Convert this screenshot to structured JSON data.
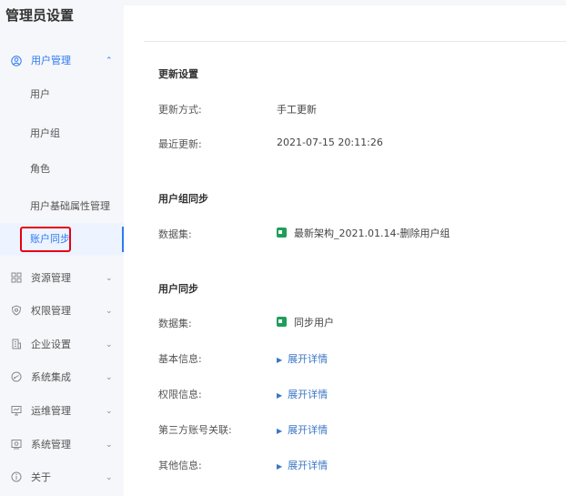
{
  "sidebar": {
    "title": "管理员设置",
    "user_mgmt": {
      "label": "用户管理",
      "subitems": [
        "用户",
        "用户组",
        "角色",
        "用户基础属性管理",
        "账户同步"
      ]
    },
    "groups": [
      {
        "label": "资源管理",
        "icon": "grid-icon"
      },
      {
        "label": "权限管理",
        "icon": "shield-icon"
      },
      {
        "label": "企业设置",
        "icon": "building-icon"
      },
      {
        "label": "系统集成",
        "icon": "integration-icon"
      },
      {
        "label": "运维管理",
        "icon": "monitor-icon"
      },
      {
        "label": "系统管理",
        "icon": "system-icon"
      },
      {
        "label": "关于",
        "icon": "info-icon"
      }
    ],
    "accent_color": "#2e7af2",
    "highlight_color": "#e60012"
  },
  "main": {
    "update": {
      "title": "更新设置",
      "method_label": "更新方式:",
      "method_value": "手工更新",
      "last_label": "最近更新:",
      "last_value": "2021-07-15 20:11:26"
    },
    "group_sync": {
      "title": "用户组同步",
      "dataset_label": "数据集:",
      "dataset_value": "最新架构_2021.01.14-删除用户组"
    },
    "user_sync": {
      "title": "用户同步",
      "dataset_label": "数据集:",
      "dataset_value": "同步用户",
      "rows": [
        {
          "label": "基本信息:",
          "value": "展开详情"
        },
        {
          "label": "权限信息:",
          "value": "展开详情"
        },
        {
          "label": "第三方账号关联:",
          "value": "展开详情"
        },
        {
          "label": "其他信息:",
          "value": "展开详情"
        }
      ]
    }
  }
}
